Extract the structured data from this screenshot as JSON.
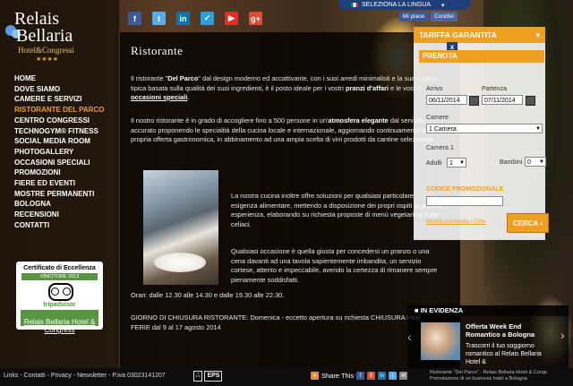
{
  "header": {
    "language_label": "SELEZIONA LA LINGUA",
    "fb_like": "Mi piace",
    "fb_share": "Condivi"
  },
  "logo": {
    "line1": "Relais",
    "line2": "Bellaria",
    "sub": "Hotel&Congressi",
    "stars": "★★★★"
  },
  "nav": {
    "items": [
      "HOME",
      "DOVE SIAMO",
      "CAMERE E SERVIZI",
      "RISTORANTE DEL PARCO",
      "CENTRO CONGRESSI",
      "TECHNOGYM® FITNESS",
      "SOCIAL MEDIA ROOM",
      "PHOTOGALLERY",
      "OCCASIONI SPECIALI",
      "PROMOZIONI",
      "FIERE ED EVENTI",
      "MOSTRE PERMANENTI",
      "BOLOGNA",
      "RECENSIONI",
      "CONTATTI"
    ],
    "active_index": 3
  },
  "certificate": {
    "title": "Certificato di Eccellenza",
    "winner": "VINCITORE 2013",
    "brand": "tripadvisor",
    "link": "Relais Bellaria Hotel & Congress"
  },
  "social": {
    "icons": [
      {
        "name": "facebook-icon",
        "glyph": "f",
        "color": "#3b5998"
      },
      {
        "name": "twitter-icon",
        "glyph": "t",
        "color": "#55acee"
      },
      {
        "name": "linkedin-icon",
        "glyph": "in",
        "color": "#0e76a8"
      },
      {
        "name": "foursquare-icon",
        "glyph": "✓",
        "color": "#2d9fe0"
      },
      {
        "name": "youtube-icon",
        "glyph": "▶",
        "color": "#e52d27"
      },
      {
        "name": "googleplus-icon",
        "glyph": "g+",
        "color": "#dd4b39"
      }
    ]
  },
  "content": {
    "title": "Ristorante",
    "p1_a": "Il ristorante \"",
    "p1_b": "Del Parco",
    "p1_c": "\" dal design moderno ed accattivante, con i suoi arredi minimalisti e la sua cucina tipica basata sulla qualità dei suoi ingredienti, è il posto ideale per i vostri ",
    "p1_d": "pranzi d'affari",
    "p1_e": " e le vostre ",
    "p1_f": "occasioni speciali",
    "p1_g": ".",
    "p2_a": "Il nostro ristorante è in grado di accogliere fino a 500 persone in un'",
    "p2_b": "atmosfera elegante",
    "p2_c": " dal servizio accurato proponendo le specialità della cucina locale e internazionale, aggiornando continuamente la propria offerta gastronomica, in abbinamento ad una ampia scelta di vini prodotti da cantine selezionate.",
    "p3": "La nostra cucina inoltre offre soluzioni per qualsiasi particolare esigenza alimentare, mettendo a disposizione dei propri ospiti la propria esperienza, elaborando su richiesta proposte di menù vegetariani o per celiaci.",
    "p4": "Qualsiasi occasione è quella giusta per concedersi un pranzo o una cena davanti ad una tavola sapientemente imbandita, un servizio cortese, attento e impeccabile, avendo la certezza di rimanere sempre pienamente soddisfatti.",
    "p5": "Orari: dalle 12.30 alle 14.30  e dalle 19.30 alle 22.30.",
    "p6": "GIORNO DI CHIUSURA RISTORANTE: Domenica - eccetto apertura su richiesta CHIUSURA PER FERIE dal 9 al 17 agosto 2014"
  },
  "booking": {
    "header": "TARIFFA GARANTITA",
    "close": "x",
    "prenota": "PRENOTA",
    "arrival_label": "Arrivo",
    "arrival_value": "06/11/2014",
    "departure_label": "Partenza",
    "departure_value": "07/11/2014",
    "rooms_label": "Camere",
    "rooms_value": "1 Camera",
    "room1_label": "Camera 1",
    "adults_label": "Adulti",
    "adults_value": "1",
    "children_label": "Bambini",
    "children_value": "0",
    "promo_label": "CODICE PROMOZIONALE",
    "modify_link": "Modifica/Annulla / Ditte",
    "search_button": "CERCA",
    "search_arrow": "›"
  },
  "evidence": {
    "header": "IN EVIDENZA",
    "title": "Offerta Week End Romantico a Bologna",
    "text": "Trascorri il tuo soggiorno romantico al Relais Bellaria Hotel &"
  },
  "footer": {
    "links": "Links - Contatti - Privacy - Newsletter - P.iva 03023141207",
    "eps": [
      "∴",
      "EPS"
    ],
    "share_label": "Share This",
    "address": "Ristorante \"Del Parco\" - Relais Bellaria Hotel & Congr. Prenotazione di un business hotel a Bologna"
  }
}
